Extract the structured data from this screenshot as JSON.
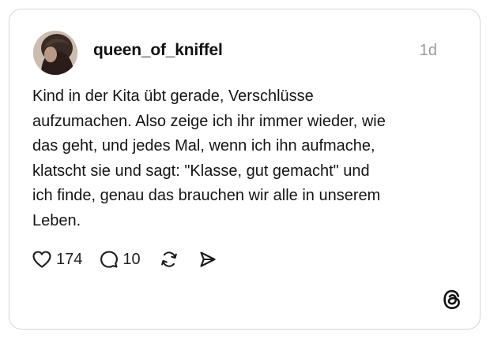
{
  "post": {
    "username": "queen_of_kniffel",
    "timestamp": "1d",
    "text": "Kind in der Kita übt gerade, Verschlüsse\naufzumachen. Also zeige ich ihr immer wieder, wie\ndas geht, und jedes Mal, wenn ich ihn aufmache,\nklatscht sie und sagt: \"Klasse, gut gemacht\" und\nich finde, genau das brauchen wir alle in unserem\nLeben.",
    "likes": "174",
    "replies": "10"
  },
  "icons": {
    "like": "heart-icon",
    "reply": "speech-bubble-icon",
    "repost": "repost-icon",
    "share": "send-icon",
    "brand": "threads-logo-icon"
  },
  "colors": {
    "card_border": "#d6d6d6",
    "timestamp": "#9a9a9a",
    "text": "#141414"
  }
}
